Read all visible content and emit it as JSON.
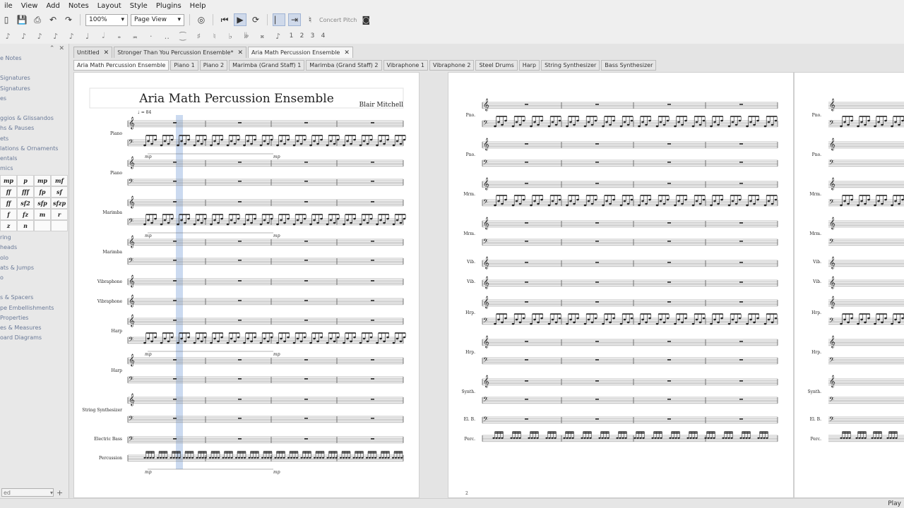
{
  "menu": [
    "ile",
    "View",
    "Add",
    "Notes",
    "Layout",
    "Style",
    "Plugins",
    "Help"
  ],
  "toolbar": {
    "zoom": "100%",
    "view_mode": "Page View",
    "concert_pitch": "Concert Pitch"
  },
  "note_input": {
    "durations": [
      "♪",
      "♪",
      "♪",
      "♪",
      "♪",
      "♩",
      "𝅗𝅥",
      "𝅝",
      "𝅜",
      "·",
      "‥"
    ],
    "voices": [
      "1",
      "2",
      "3",
      "4"
    ],
    "accidentals": [
      "♯",
      "♮",
      "♭",
      "𝄫",
      "𝄪"
    ]
  },
  "palette": {
    "items_top": [
      "e Notes",
      "",
      "Signatures",
      "Signatures",
      "es",
      "",
      "ggios & Glissandos",
      "hs & Pauses",
      "ets",
      "lations & Ornaments",
      "entals",
      "mics"
    ],
    "dynamics": [
      "mp",
      "p",
      "mp",
      "mf",
      "ff",
      "fff",
      "fp",
      "sf",
      "ff",
      "sf2",
      "sfp",
      "sfzp",
      "f",
      "fz",
      "m",
      "r",
      "z",
      "n",
      "",
      ""
    ],
    "items_bottom": [
      "ring",
      "heads",
      "olo",
      "ats & Jumps",
      "o",
      "",
      "s & Spacers",
      "pe Embellishments",
      "Properties",
      "es & Measures",
      "oard Diagrams"
    ],
    "footer_combo": "ed"
  },
  "doc_tabs": [
    {
      "label": "Untitled",
      "close": "✕"
    },
    {
      "label": "Stronger Than You Percussion Ensemble*",
      "close": "✕"
    },
    {
      "label": "Aria Math Percussion Ensemble",
      "close": "✕"
    }
  ],
  "part_tabs": [
    "Aria Math Percussion Ensemble",
    "Piano 1",
    "Piano 2",
    "Marimba (Grand Staff) 1",
    "Marimba (Grand Staff) 2",
    "Vibraphone 1",
    "Vibraphone 2",
    "Steel Drums",
    "Harp",
    "String Synthesizer",
    "Bass Synthesizer"
  ],
  "score": {
    "title": "Aria Math Percussion Ensemble",
    "composer": "Blair Mitchell",
    "tempo": "♩ = 84",
    "dynamic": "mp",
    "page_number": "2",
    "page1_instruments": [
      "Piano",
      "Piano",
      "Marimba",
      "Marimba",
      "Vibraphone",
      "Vibraphone",
      "Harp",
      "Harp",
      "String Synthesizer",
      "Electric Bass",
      "Percussion"
    ],
    "page2_instruments": [
      "Pno.",
      "Pno.",
      "Mrm.",
      "Mrm.",
      "Vib.",
      "Vib.",
      "Hrp.",
      "Hrp.",
      "Synth.",
      "El. B.",
      "Perc."
    ]
  },
  "status": {
    "text": "Play"
  }
}
